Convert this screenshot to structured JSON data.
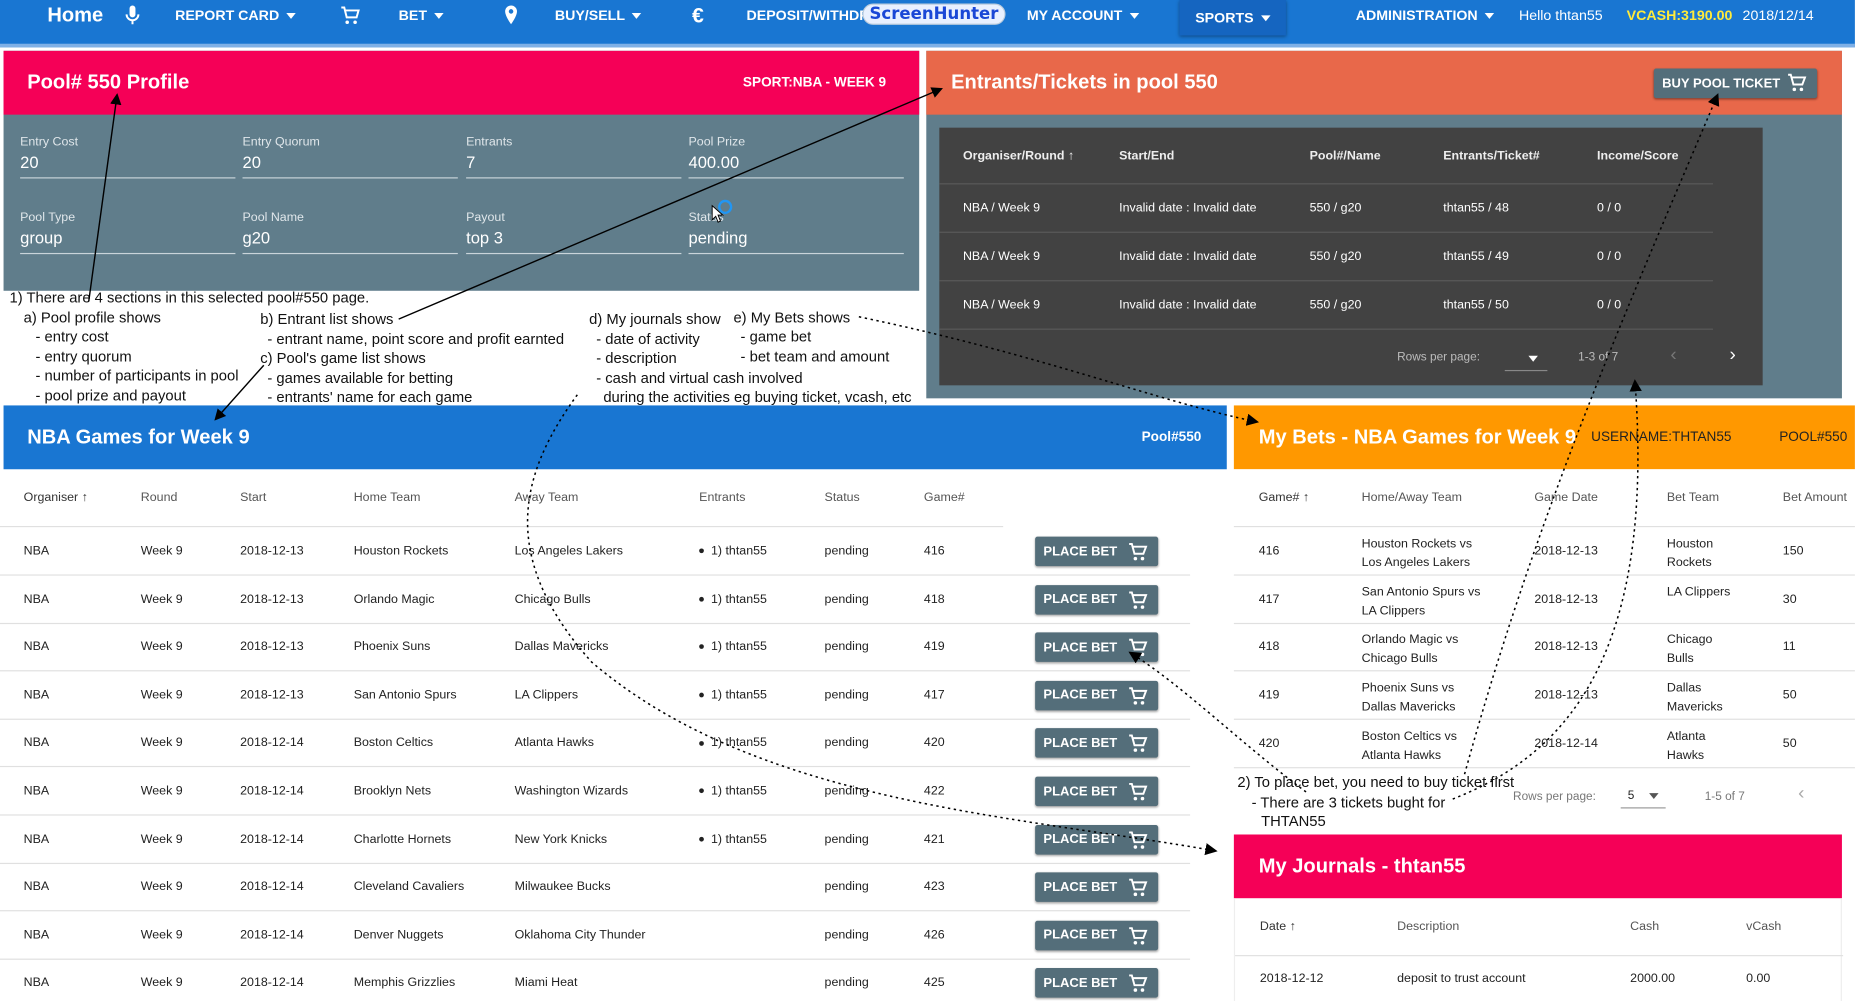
{
  "nav": {
    "home": "Home",
    "report_card": "REPORT CARD",
    "bet": "BET",
    "buy_sell": "BUY/SELL",
    "deposit": "DEPOSIT/WITHDR",
    "screenhunter": "ScreenHunter",
    "my_account": "MY ACCOUNT",
    "sports": "SPORTS",
    "administration": "ADMINISTRATION",
    "hello": "Hello thtan55",
    "vcash": "VCASH:3190.00",
    "date": "2018/12/14",
    "vcash_color": "#ffeb3b"
  },
  "profile": {
    "title": "Pool# 550 Profile",
    "sport": "SPORT:NBA - WEEK 9",
    "color": "#f50057",
    "fields": [
      {
        "label": "Entry Cost",
        "value": "20"
      },
      {
        "label": "Entry Quorum",
        "value": "20"
      },
      {
        "label": "Entrants",
        "value": "7"
      },
      {
        "label": "Pool Prize",
        "value": "400.00"
      },
      {
        "label": "Pool Type",
        "value": "group"
      },
      {
        "label": "Pool Name",
        "value": "g20"
      },
      {
        "label": "Payout",
        "value": "top 3"
      },
      {
        "label": "Status",
        "value": "pending"
      }
    ]
  },
  "entrants": {
    "title": "Entrants/Tickets in pool 550",
    "buy_button": "BUY POOL TICKET",
    "color": "#e8684a",
    "columns": [
      "Organiser/Round",
      "Start/End",
      "Pool#/Name",
      "Entrants/Ticket#",
      "Income/Score"
    ],
    "rows": [
      [
        "NBA / Week 9",
        "Invalid date : Invalid date",
        "550 / g20",
        "thtan55 / 48",
        "0 / 0"
      ],
      [
        "NBA / Week 9",
        "Invalid date : Invalid date",
        "550 / g20",
        "thtan55 / 49",
        "0 / 0"
      ],
      [
        "NBA / Week 9",
        "Invalid date : Invalid date",
        "550 / g20",
        "thtan55 / 50",
        "0 / 0"
      ]
    ],
    "rows_per_page": "Rows per page:",
    "range": "1-3 of 7"
  },
  "games": {
    "title": "NBA Games for Week 9",
    "pool": "Pool#550",
    "color": "#1976d2",
    "columns": [
      "Organiser",
      "Round",
      "Start",
      "Home Team",
      "Away Team",
      "Entrants",
      "Status",
      "Game#"
    ],
    "button": "PLACE BET",
    "rows": [
      [
        "NBA",
        "Week 9",
        "2018-12-13",
        "Houston Rockets",
        "Los Angeles Lakers",
        "1) thtan55",
        "pending",
        "416"
      ],
      [
        "NBA",
        "Week 9",
        "2018-12-13",
        "Orlando Magic",
        "Chicago Bulls",
        "1) thtan55",
        "pending",
        "418"
      ],
      [
        "NBA",
        "Week 9",
        "2018-12-13",
        "Phoenix Suns",
        "Dallas Mavericks",
        "1) thtan55",
        "pending",
        "419"
      ],
      [
        "NBA",
        "Week 9",
        "2018-12-13",
        "San Antonio Spurs",
        "LA Clippers",
        "1) thtan55",
        "pending",
        "417"
      ],
      [
        "NBA",
        "Week 9",
        "2018-12-14",
        "Boston Celtics",
        "Atlanta Hawks",
        "1) thtan55",
        "pending",
        "420"
      ],
      [
        "NBA",
        "Week 9",
        "2018-12-14",
        "Brooklyn Nets",
        "Washington Wizards",
        "1) thtan55",
        "pending",
        "422"
      ],
      [
        "NBA",
        "Week 9",
        "2018-12-14",
        "Charlotte Hornets",
        "New York Knicks",
        "1) thtan55",
        "pending",
        "421"
      ],
      [
        "NBA",
        "Week 9",
        "2018-12-14",
        "Cleveland Cavaliers",
        "Milwaukee Bucks",
        "",
        "pending",
        "423"
      ],
      [
        "NBA",
        "Week 9",
        "2018-12-14",
        "Denver Nuggets",
        "Oklahoma City Thunder",
        "",
        "pending",
        "426"
      ],
      [
        "NBA",
        "Week 9",
        "2018-12-14",
        "Memphis Grizzlies",
        "Miami Heat",
        "",
        "pending",
        "425"
      ]
    ]
  },
  "bets": {
    "title": "My Bets - NBA Games for Week 9",
    "username": "USERNAME:THTAN55",
    "pool": "POOL#550",
    "color": "#ff9800",
    "columns": [
      "Game#",
      "Home/Away Team",
      "Game Date",
      "Bet Team",
      "Bet Amount"
    ],
    "rows": [
      [
        "416",
        "Houston Rockets vs",
        "Los Angeles Lakers",
        "2018-12-13",
        "Houston",
        "Rockets",
        "150"
      ],
      [
        "417",
        "San Antonio Spurs vs",
        "LA Clippers",
        "2018-12-13",
        "LA Clippers",
        "",
        "30"
      ],
      [
        "418",
        "Orlando Magic vs",
        "Chicago Bulls",
        "2018-12-13",
        "Chicago",
        "Bulls",
        "11"
      ],
      [
        "419",
        "Phoenix Suns vs",
        "Dallas Mavericks",
        "2018-12-13",
        "Dallas",
        "Mavericks",
        "50"
      ],
      [
        "420",
        "Boston Celtics vs",
        "Atlanta Hawks",
        "2018-12-14",
        "Atlanta",
        "Hawks",
        "50"
      ]
    ],
    "rows_per_page": "Rows per page:",
    "per_page_value": "5",
    "range": "1-5 of 7"
  },
  "journals": {
    "title": "My Journals - thtan55",
    "color": "#f50057",
    "columns": [
      "Date",
      "Description",
      "Cash",
      "vCash"
    ],
    "rows": [
      [
        "2018-12-12",
        "deposit to trust account",
        "2000.00",
        "0.00"
      ]
    ]
  },
  "annotations": [
    "1) There are 4 sections in this selected pool#550 page.",
    "a) Pool profile shows",
    "- entry cost",
    "- entry quorum",
    "- number of participants in pool",
    "- pool prize and payout",
    "b) Entrant list shows",
    "- entrant name, point score and profit earnted",
    "c) Pool's game list shows",
    "- games available for betting",
    "- entrants' name for each game",
    "d) My journals show",
    "- date of activity",
    "- description",
    "- cash and virtual cash involved",
    "during the activities eg buying ticket, vcash, etc",
    "e) My Bets shows",
    "- game bet",
    "- bet team and amount",
    "2) To place bet, you need to buy ticket first",
    "- There are 3 tickets bught for",
    "THTAN55"
  ]
}
